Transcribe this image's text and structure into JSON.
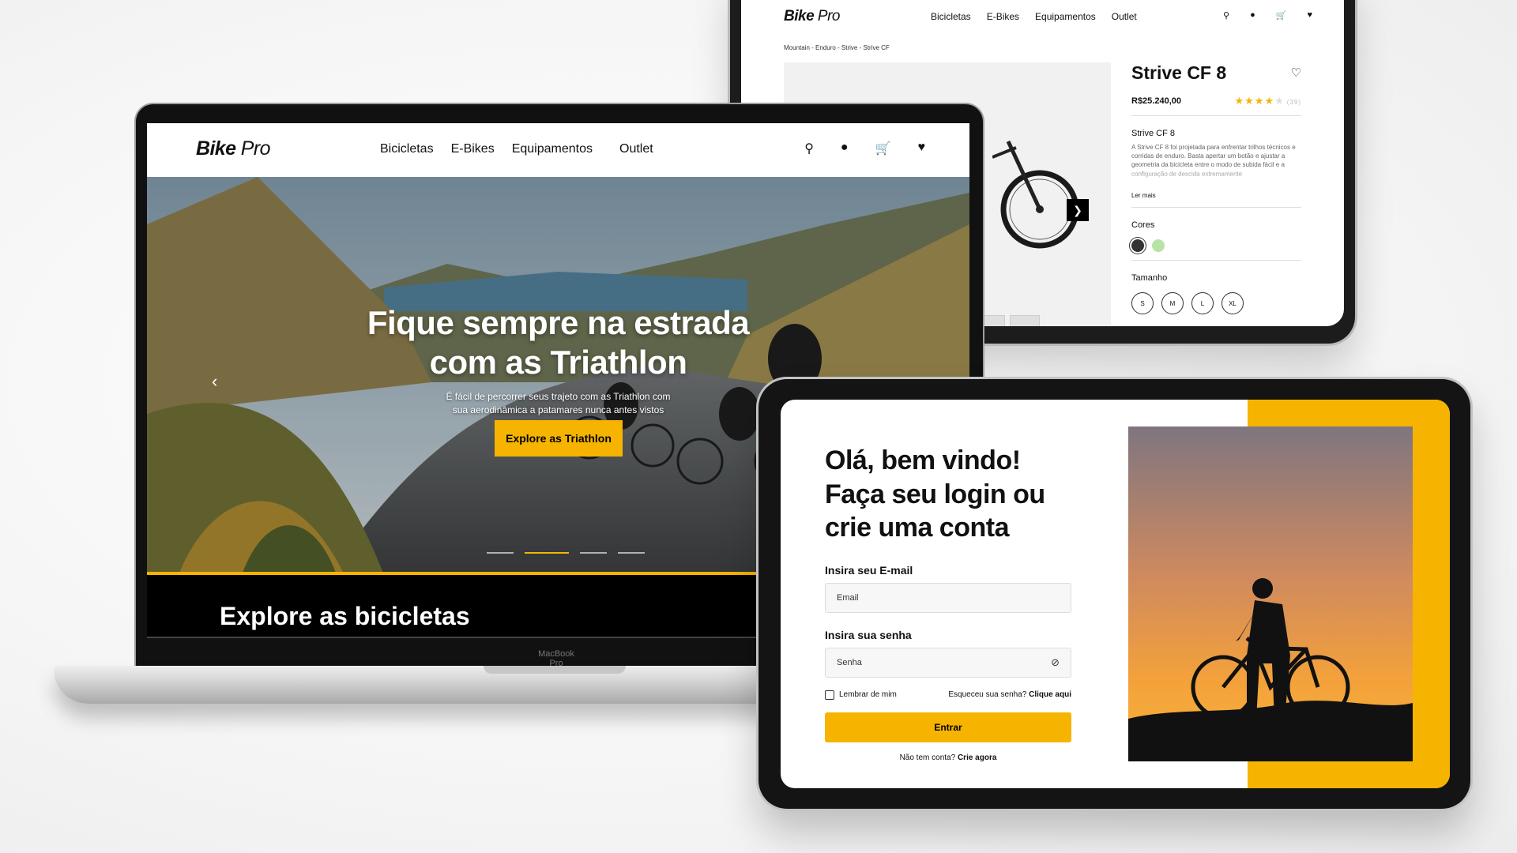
{
  "brand": {
    "logo_bold": "Bike",
    "logo_light": "Pro"
  },
  "nav": {
    "items": [
      "Bicicletas",
      "E-Bikes",
      "Equipamentos",
      "Outlet"
    ]
  },
  "product": {
    "breadcrumb": "Mountain - Enduro - Strive - Strive CF",
    "name": "Strive CF 8",
    "price": "R$25.240,00",
    "rating": 4,
    "rating_max": 5,
    "review_count": "(39)",
    "subtitle": "Strive CF 8",
    "description": "A Strive CF 8 foi projetada para enfrentar trilhos técnicos e corridas de enduro. Basta apertar um botão e ajustar a geometria da bicicleta entre o modo de subida fácil e a configuração de descida extremamente",
    "read_more": "Ler mais",
    "colors_label": "Cores",
    "colors": [
      "#333333",
      "#b7e4a6"
    ],
    "size_label": "Tamanho",
    "sizes": [
      "S",
      "M",
      "L",
      "XL"
    ]
  },
  "hero": {
    "title_line1": "Fique sempre na estrada",
    "title_line2": "com as Triathlon",
    "subtitle_line1": "É fácil de percorrer seus trajeto com as Triathlon com",
    "subtitle_line2": "sua aerodinâmica a patamares nunca antes vistos",
    "cta": "Explore as Triathlon",
    "slide_count": 4,
    "active_slide": 1
  },
  "section": {
    "title": "Explore as bicicletas"
  },
  "laptop": {
    "model_label": "MacBook Pro"
  },
  "login": {
    "title_line1": "Olá, bem vindo!",
    "title_line2": "Faça seu login ou",
    "title_line3": "crie uma conta",
    "email_label": "Insira seu E-mail",
    "email_placeholder": "Email",
    "password_label": "Insira sua senha",
    "password_placeholder": "Senha",
    "remember": "Lembrar de mim",
    "forgot_text": "Esqueceu sua senha?",
    "forgot_link": "Clique aqui",
    "submit": "Entrar",
    "signup_text": "Não tem conta?",
    "signup_link": "Crie agora"
  },
  "colors": {
    "accent": "#f6b400",
    "dark": "#111111"
  }
}
